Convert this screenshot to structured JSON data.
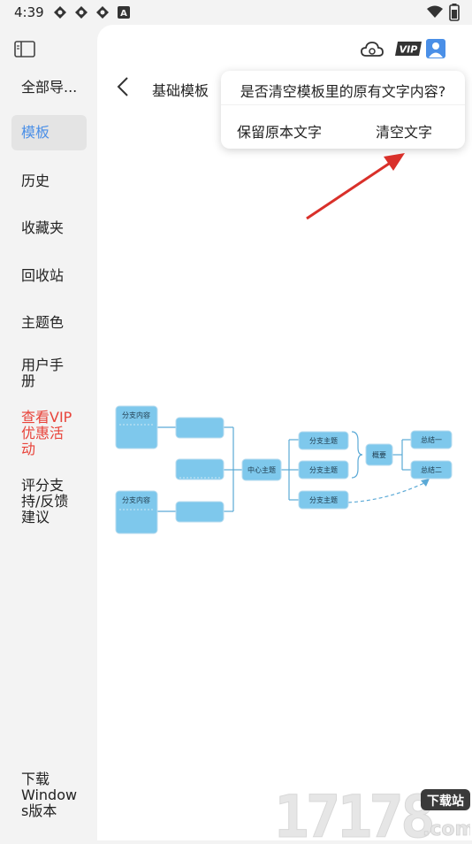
{
  "status_bar": {
    "time": "4:39",
    "icons": [
      "sync-icon",
      "sync-icon",
      "sync-icon",
      "font-a-icon",
      "wifi-icon",
      "battery-icon"
    ]
  },
  "sidebar": {
    "items": [
      {
        "label": "全部导..."
      },
      {
        "label": "模板",
        "active": true
      },
      {
        "label": "历史"
      },
      {
        "label": "收藏夹"
      },
      {
        "label": "回收站"
      },
      {
        "label": "主题色"
      },
      {
        "label": "用户手\n册"
      },
      {
        "label": "查看VIP\n优惠活\n动",
        "highlight": true
      },
      {
        "label": "评分支\n持/反馈\n建议"
      },
      {
        "label": "下载\nWindow\ns版本"
      }
    ]
  },
  "header": {
    "title": "基础模板",
    "icons": [
      "cloud-icon",
      "vip-badge-icon",
      "user-icon"
    ],
    "vip_text": "VIP"
  },
  "dialog": {
    "question": "是否清空模板里的原有文字内容?",
    "keep_label": "保留原本文字",
    "clear_label": "清空文字"
  },
  "mindmap": {
    "center": "中心主题",
    "branches": [
      "分支主题",
      "分支主题",
      "分支主题"
    ],
    "summary": "概要",
    "summary_items": [
      "总结一",
      "总结二"
    ],
    "left_content": [
      "分支内容",
      "分支内容"
    ]
  },
  "watermark": {
    "digits": "17178",
    "badge": "下载站",
    "domain": ".com"
  },
  "colors": {
    "accent": "#4a8fe7",
    "vip_red": "#e8433a",
    "node_fill": "#7ec8ec",
    "node_line": "#5aa9d6"
  }
}
